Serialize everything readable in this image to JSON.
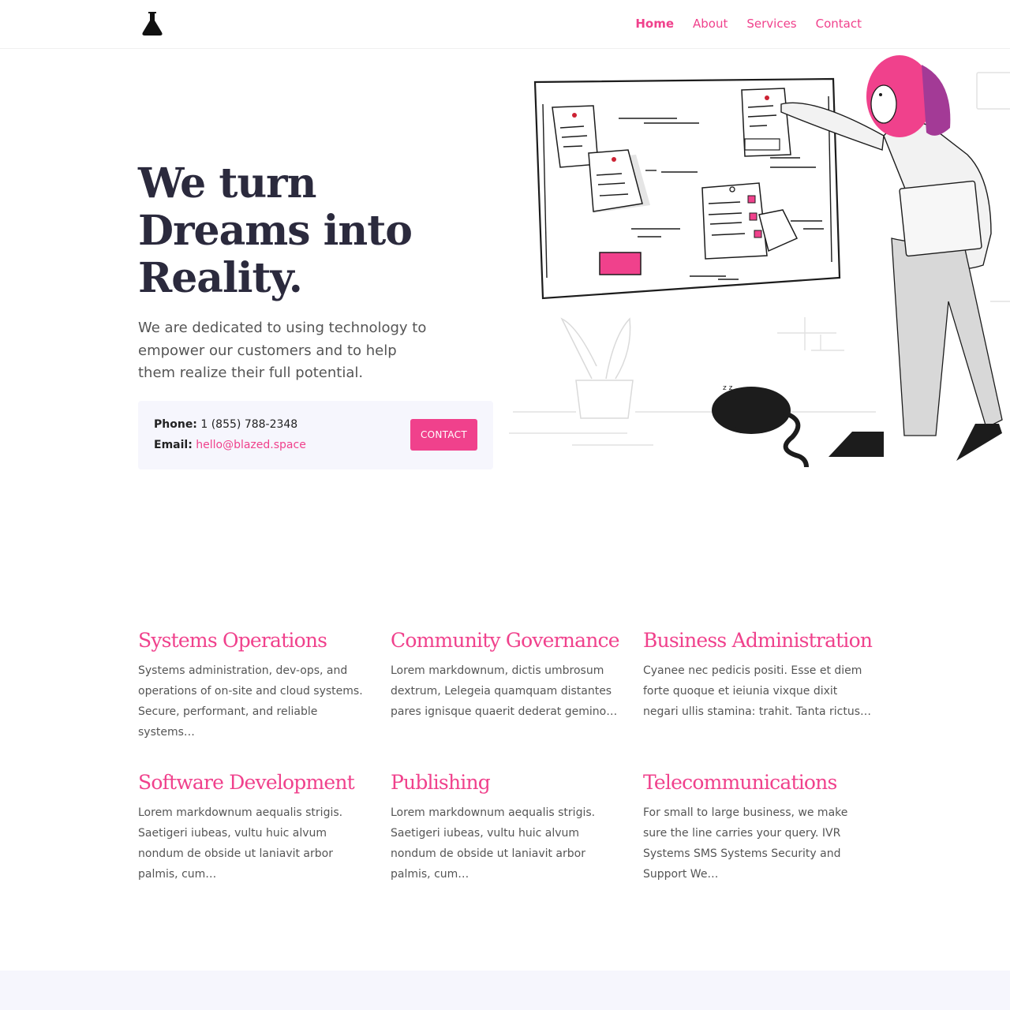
{
  "header": {
    "logo_icon": "flask-icon",
    "nav": [
      {
        "label": "Home",
        "active": true
      },
      {
        "label": "About",
        "active": false
      },
      {
        "label": "Services",
        "active": false
      },
      {
        "label": "Contact",
        "active": false
      }
    ]
  },
  "hero": {
    "title": "We turn Dreams into Reality.",
    "subtitle": "We are dedicated to using technology to empower our customers and to help them realize their full potential.",
    "contact": {
      "phone_label": "Phone:",
      "phone_value": "1 (855) 788-2348",
      "email_label": "Email:",
      "email_value": "hello@blazed.space",
      "button_label": "CONTACT"
    }
  },
  "services": [
    {
      "title": "Systems Operations",
      "text": "Systems administration, dev-ops, and operations of on-site and cloud systems. Secure, performant, and reliable systems…"
    },
    {
      "title": "Community Governance",
      "text": "Lorem markdownum, dictis umbrosum dextrum, Lelegeia quamquam distantes pares ignisque quaerit dederat gemino…"
    },
    {
      "title": "Business Administration",
      "text": "Cyanee nec pedicis positi. Esse et diem forte quoque et ieiunia vixque dixit negari ullis stamina: trahit. Tanta rictus…"
    },
    {
      "title": "Software Development",
      "text": "Lorem markdownum aequalis strigis. Saetigeri iubeas, vultu huic alvum nondum de obside ut laniavit arbor palmis, cum…"
    },
    {
      "title": "Publishing",
      "text": "Lorem markdownum aequalis strigis. Saetigeri iubeas, vultu huic alvum nondum de obside ut laniavit arbor palmis, cum…"
    },
    {
      "title": "Telecommunications",
      "text": "For small to large business, we make sure the line carries your query. IVR Systems SMS Systems Security and Support We…"
    }
  ],
  "colors": {
    "accent": "#f0418c",
    "heading": "#2b2a3d",
    "panel": "#f6f6fd"
  }
}
